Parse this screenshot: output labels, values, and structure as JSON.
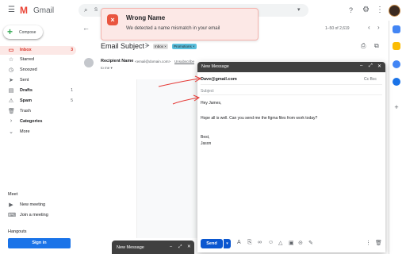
{
  "app": {
    "logo_text": "Gmail"
  },
  "search": {
    "text": "S"
  },
  "sidebar": {
    "compose_label": "Compose",
    "items": [
      {
        "label": "Inbox",
        "count": "3"
      },
      {
        "label": "Starred",
        "count": ""
      },
      {
        "label": "Snoozed",
        "count": ""
      },
      {
        "label": "Sent",
        "count": ""
      },
      {
        "label": "Drafts",
        "count": "1"
      },
      {
        "label": "Spam",
        "count": "5"
      },
      {
        "label": "Trash",
        "count": ""
      },
      {
        "label": "Categories",
        "count": ""
      },
      {
        "label": "More",
        "count": ""
      }
    ],
    "meet": {
      "title": "Meet",
      "new_meeting": "New meeting",
      "join_meeting": "Join a meeting"
    },
    "hangouts": {
      "title": "Hangouts",
      "sign_in": "Sign in"
    }
  },
  "toast": {
    "title": "Wrong Name",
    "message": "We detected a name mismatch in your email"
  },
  "email": {
    "pager": "1–50 of 2,619",
    "subject": "Email Subject",
    "tags": [
      "Inbox ×",
      "Promotions ×"
    ],
    "sender_name": "Recipient Name",
    "sender_email": "<email@domain.com>",
    "unsubscribe": "Unsubscribe",
    "to": "to me ▾"
  },
  "compose": {
    "title": "New Message",
    "to": "Dave@gmail.com",
    "cc_bcc": "Cc Bcc",
    "subject_placeholder": "Subject",
    "body": [
      "Hey James,",
      "Hope all is well. Can you send me the figma files from work today?",
      "Best,",
      "Jason"
    ],
    "send_label": "Send"
  },
  "mini_compose": {
    "title": "New Message"
  },
  "colors": {
    "accent": "#d93025",
    "send": "#0b57d0",
    "toast_bg": "#fce8e6"
  }
}
